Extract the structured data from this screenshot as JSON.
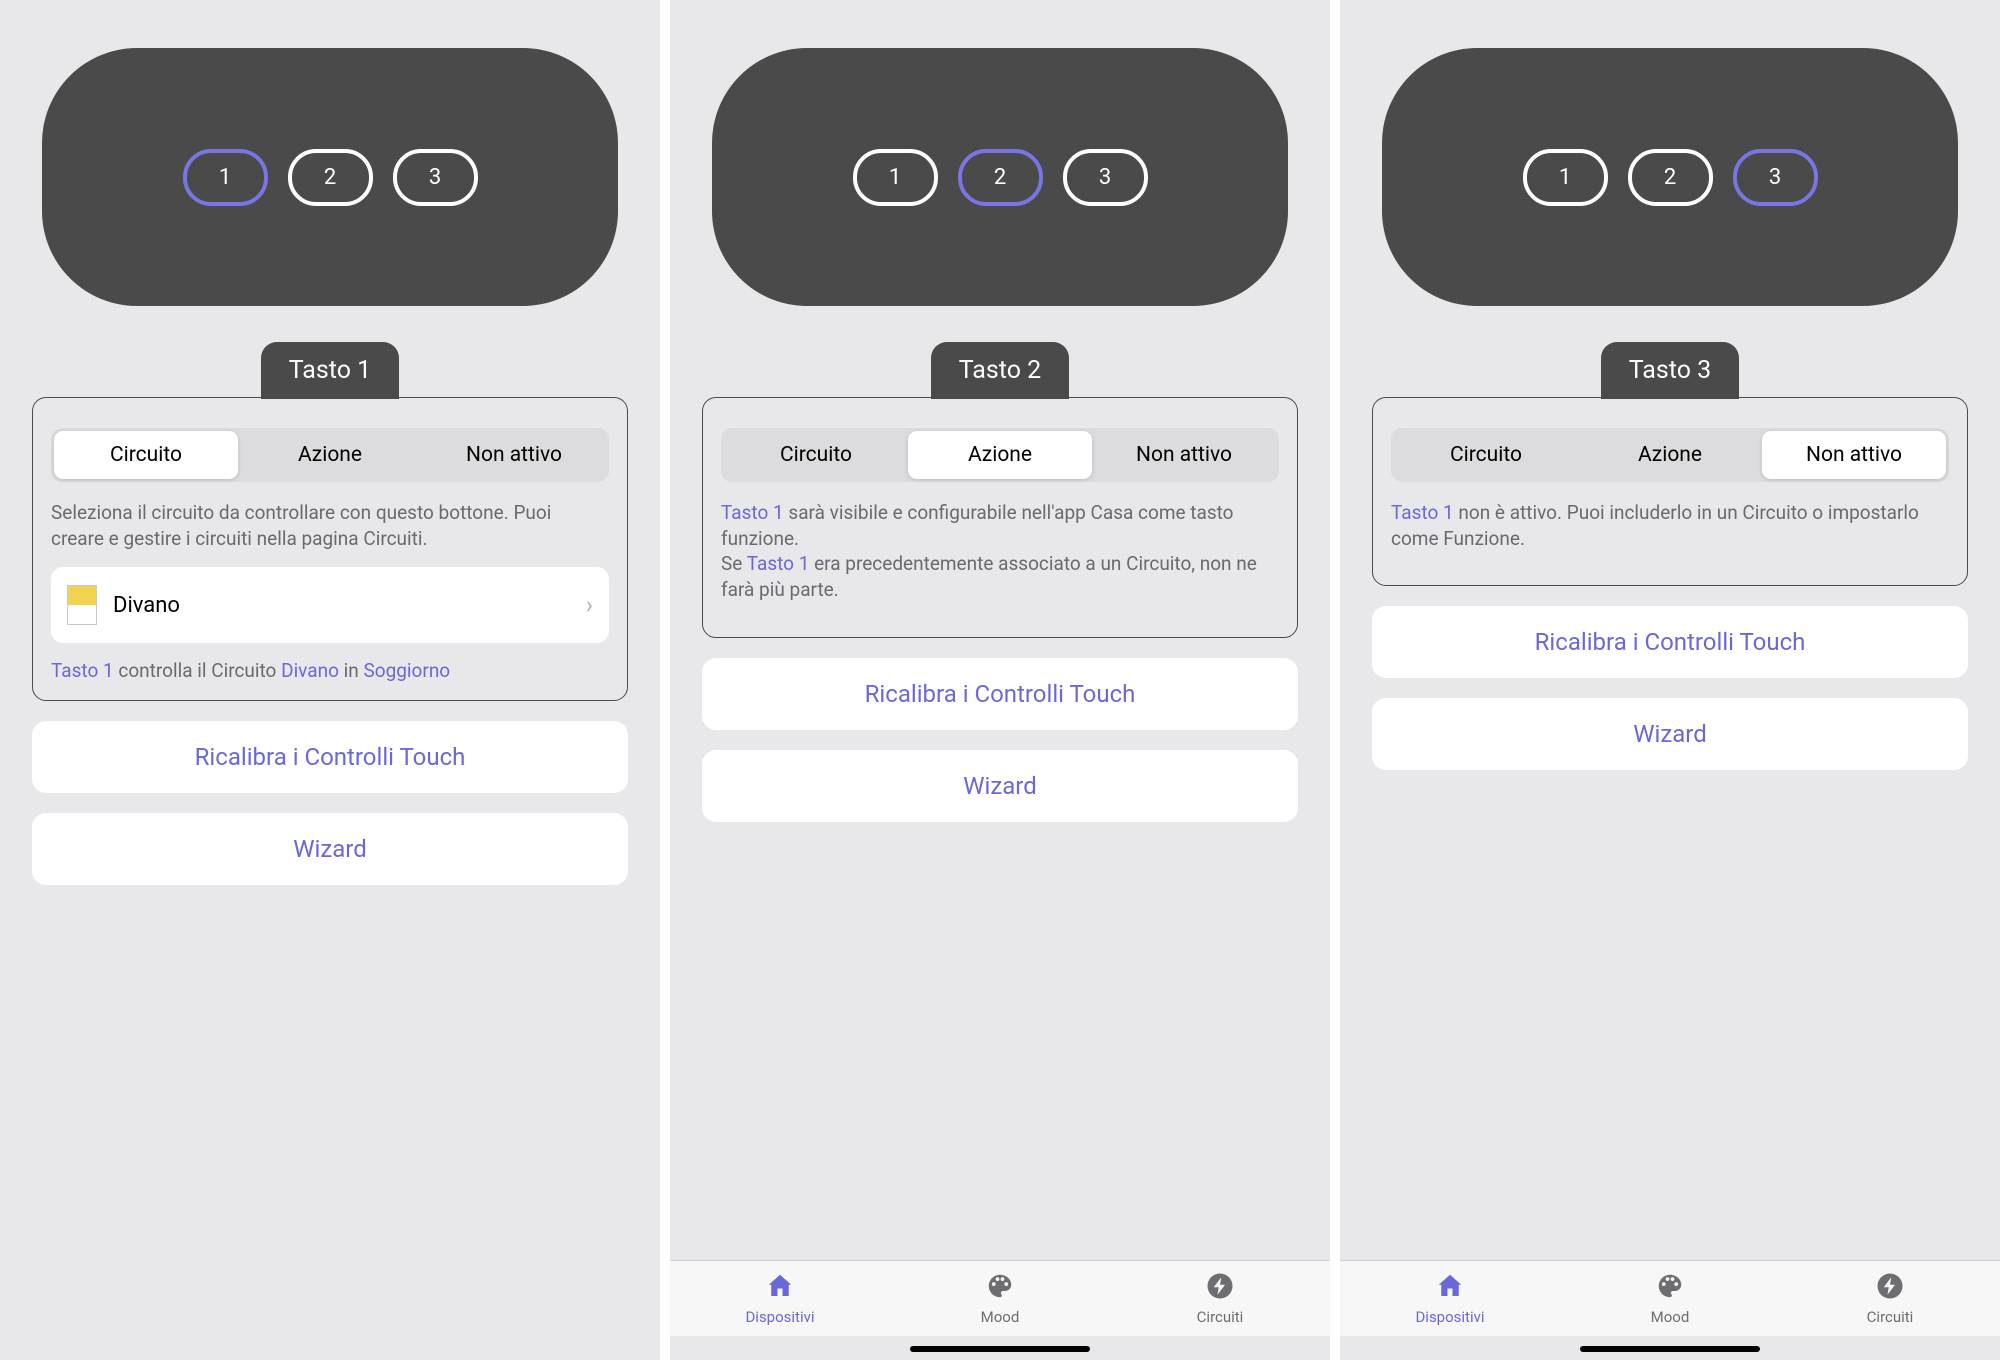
{
  "common": {
    "btn1": "1",
    "btn2": "2",
    "btn3": "3",
    "seg_circuito": "Circuito",
    "seg_azione": "Azione",
    "seg_nonattivo": "Non attivo",
    "recalibrate": "Ricalibra i Controlli Touch",
    "wizard": "Wizard",
    "tab_dispositivi": "Dispositivi",
    "tab_mood": "Mood",
    "tab_circuiti": "Circuiti"
  },
  "s1": {
    "title": "Tasto 1",
    "desc": "Seleziona il circuito da controllare con questo bottone. Puoi creare e gestire i circuiti nella pagina Circuiti.",
    "item": "Divano",
    "foot_a": "Tasto 1",
    "foot_b": " controlla il Circuito ",
    "foot_c": "Divano",
    "foot_d": " in ",
    "foot_e": "Soggiorno"
  },
  "s2": {
    "title": "Tasto 2",
    "d1a": "Tasto 1",
    "d1b": " sarà visibile e configurabile nell'app Casa come tasto funzione.",
    "d2a": "Se ",
    "d2b": "Tasto 1",
    "d2c": " era precedentemente associato a un Circuito, non ne farà più parte."
  },
  "s3": {
    "title": "Tasto 3",
    "d1a": "Tasto 1",
    "d1b": " non è attivo. Puoi includerlo in un Circuito o impostarlo come Funzione."
  }
}
